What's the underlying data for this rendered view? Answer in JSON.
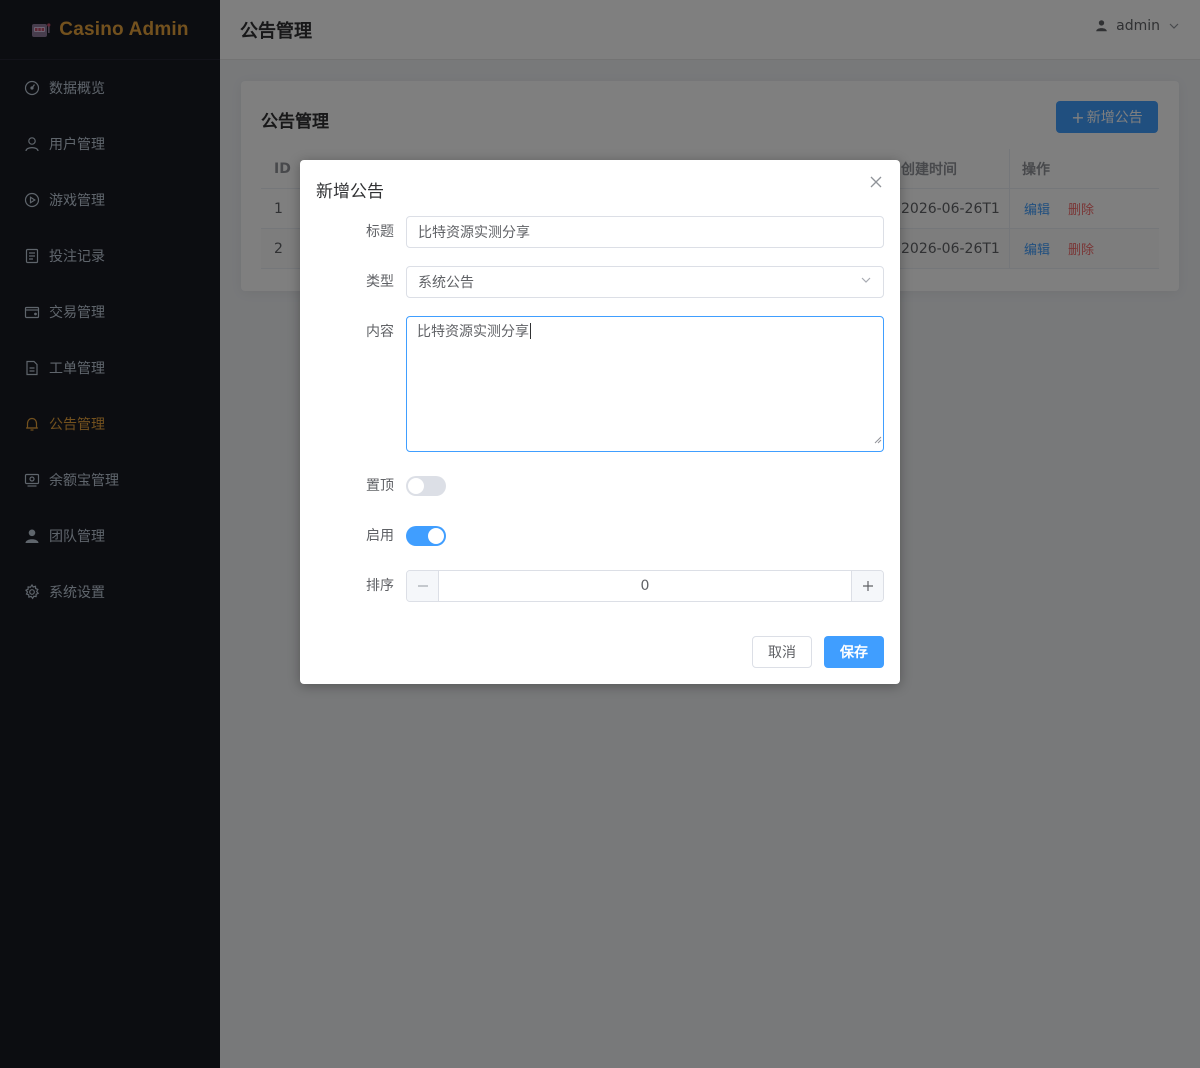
{
  "brand": {
    "name": "Casino Admin"
  },
  "sidebar": {
    "items": [
      {
        "label": "数据概览",
        "icon": "dashboard-icon",
        "active": false
      },
      {
        "label": "用户管理",
        "icon": "user-icon",
        "active": false
      },
      {
        "label": "游戏管理",
        "icon": "play-circle-icon",
        "active": false
      },
      {
        "label": "投注记录",
        "icon": "document-list-icon",
        "active": false
      },
      {
        "label": "交易管理",
        "icon": "wallet-icon",
        "active": false
      },
      {
        "label": "工单管理",
        "icon": "document-icon",
        "active": false
      },
      {
        "label": "公告管理",
        "icon": "bell-icon",
        "active": true
      },
      {
        "label": "余额宝管理",
        "icon": "money-icon",
        "active": false
      },
      {
        "label": "团队管理",
        "icon": "team-icon",
        "active": false
      },
      {
        "label": "系统设置",
        "icon": "gear-icon",
        "active": false
      }
    ]
  },
  "header": {
    "title": "公告管理",
    "user": "admin"
  },
  "card": {
    "title": "公告管理",
    "add_label": "新增公告",
    "columns": {
      "id": "ID",
      "created": "创建时间",
      "actions": "操作"
    },
    "rows": [
      {
        "id": "1",
        "created": "2026-06-26T1",
        "edit": "编辑",
        "delete": "删除"
      },
      {
        "id": "2",
        "created": "2026-06-26T1",
        "edit": "编辑",
        "delete": "删除"
      }
    ]
  },
  "dialog": {
    "title": "新增公告",
    "fields": {
      "title_label": "标题",
      "title_value": "比特资源实测分享",
      "type_label": "类型",
      "type_value": "系统公告",
      "content_label": "内容",
      "content_value": "比特资源实测分享",
      "pinned_label": "置顶",
      "pinned_on": false,
      "enabled_label": "启用",
      "enabled_on": true,
      "sort_label": "排序",
      "sort_value": "0"
    },
    "cancel_label": "取消",
    "save_label": "保存"
  },
  "colors": {
    "sidebar_bg": "#191a23",
    "accent": "#e6a23c",
    "primary": "#409eff",
    "danger": "#f56c6c"
  }
}
